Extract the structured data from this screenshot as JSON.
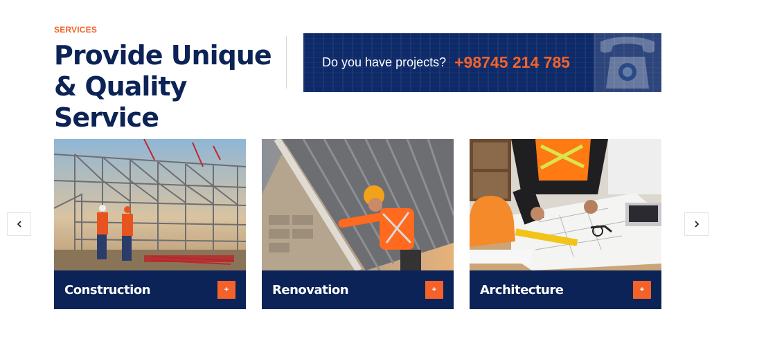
{
  "section": {
    "eyebrow": "SERVICES",
    "headline_line1": "Provide Unique",
    "headline_line2": "& Quality Service"
  },
  "cta": {
    "question": "Do you have projects?",
    "phone": "+98745 214 785"
  },
  "carousel": {
    "prev_icon": "chevron-left-icon",
    "next_icon": "chevron-right-icon",
    "cards": [
      {
        "title": "Construction",
        "image": "construction-site-workers-photo",
        "action_icon": "plus-icon"
      },
      {
        "title": "Renovation",
        "image": "roof-worker-photo",
        "action_icon": "plus-icon"
      },
      {
        "title": "Architecture",
        "image": "architect-blueprints-photo",
        "action_icon": "plus-icon"
      }
    ]
  },
  "colors": {
    "navy": "#0b2356",
    "accent": "#f4622a",
    "cta_bg": "#0e2a68"
  }
}
